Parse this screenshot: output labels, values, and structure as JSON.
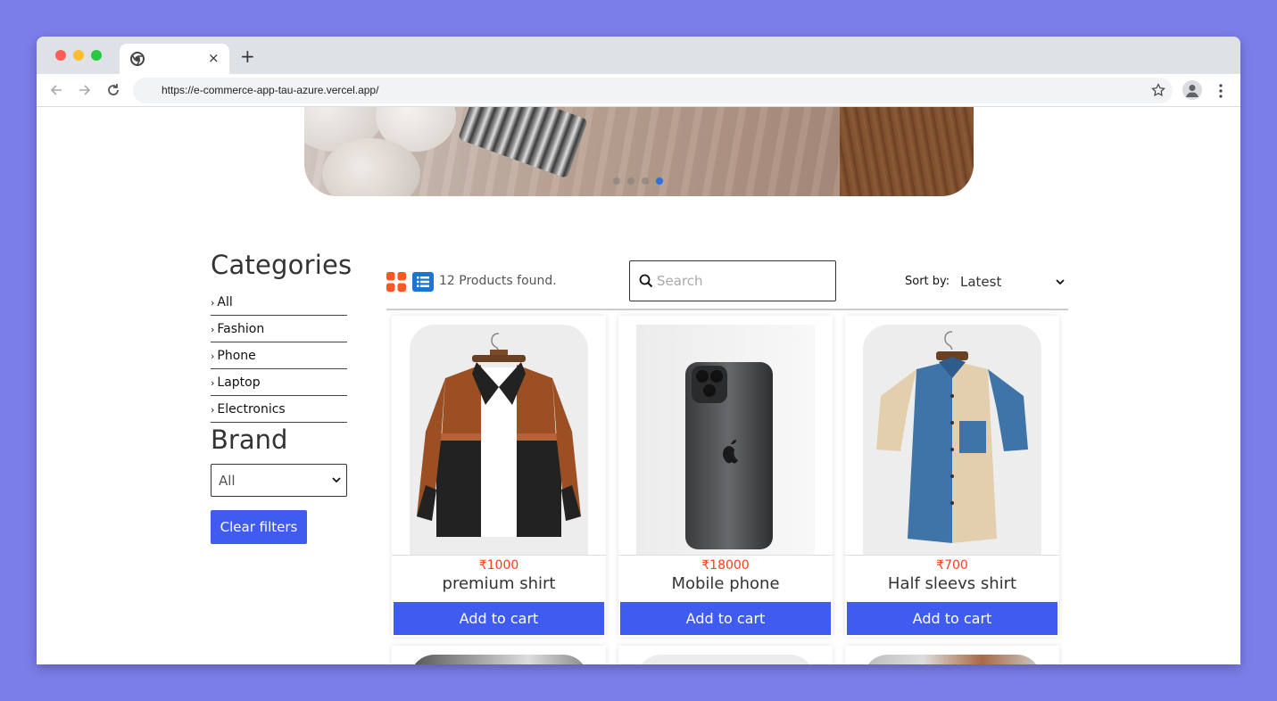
{
  "browser": {
    "url": "https://e-commerce-app-tau-azure.vercel.app/",
    "tab_close": "×",
    "new_tab": "+"
  },
  "sidebar": {
    "categories_title": "Categories",
    "categories": [
      "All",
      "Fashion",
      "Phone",
      "Laptop",
      "Electronics"
    ],
    "brand_title": "Brand",
    "brand_selected": "All",
    "clear_filters": "Clear filters"
  },
  "toolbar": {
    "found_text": "12 Products found.",
    "search_placeholder": "Search",
    "sort_label": "Sort by:",
    "sort_value": "Latest"
  },
  "products": [
    {
      "price": "₹1000",
      "name": "premium shirt",
      "button": "Add to cart"
    },
    {
      "price": "₹18000",
      "name": "Mobile phone",
      "button": "Add to cart"
    },
    {
      "price": "₹700",
      "name": "Half sleevs shirt",
      "button": "Add to cart"
    }
  ],
  "colors": {
    "accent": "#3f5bf0",
    "price": "#ff3d1f",
    "grid_icon": "#ff5722",
    "list_icon": "#1976d2",
    "background": "#7b7ee9"
  },
  "carousel": {
    "slides": 4,
    "active": 4
  }
}
